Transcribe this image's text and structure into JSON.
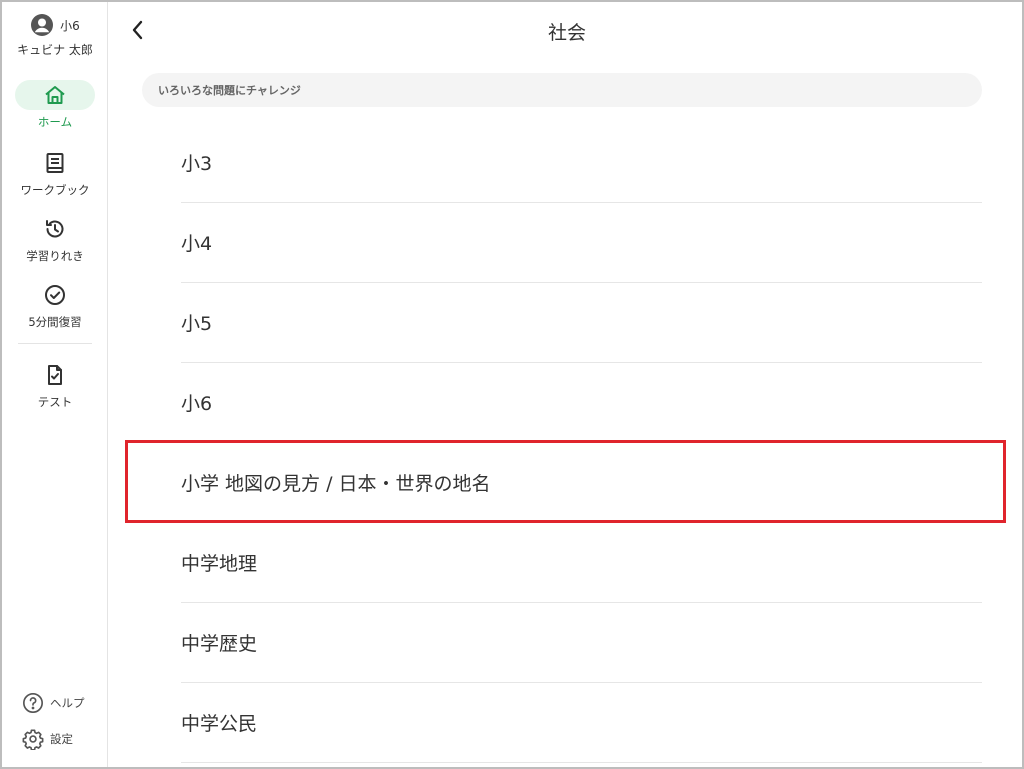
{
  "user": {
    "grade": "小6",
    "name": "キュビナ 太郎"
  },
  "sidebar": {
    "items": [
      {
        "label": "ホーム",
        "icon": "home-icon",
        "active": true
      },
      {
        "label": "ワークブック",
        "icon": "book-icon",
        "active": false
      },
      {
        "label": "学習りれき",
        "icon": "history-icon",
        "active": false
      },
      {
        "label": "5分間復習",
        "icon": "check-circle-icon",
        "active": false
      },
      {
        "label": "テスト",
        "icon": "test-document-icon",
        "active": false
      }
    ],
    "help_label": "ヘルプ",
    "settings_label": "設定"
  },
  "header": {
    "title": "社会",
    "back_icon": "chevron-left-icon"
  },
  "banner": {
    "label": "いろいろな問題にチャレンジ"
  },
  "list": {
    "items": [
      "小3",
      "小4",
      "小5",
      "小6",
      "小学 地図の見方 / 日本・世界の地名",
      "中学地理",
      "中学歴史",
      "中学公民"
    ],
    "highlighted_index": 4
  },
  "colors": {
    "accent": "#1f9a4f",
    "accent_bg": "#e6f6ec",
    "highlight": "#e0242c",
    "divider": "#e6e6e6"
  }
}
